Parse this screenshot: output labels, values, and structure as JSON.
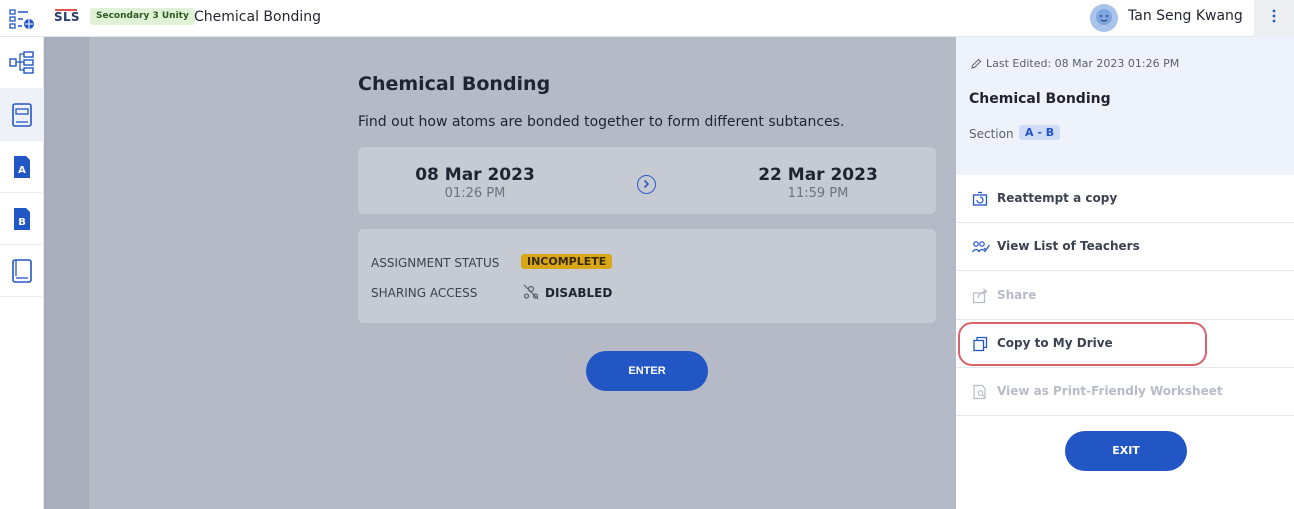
{
  "topbar": {
    "logo": "SLS",
    "class_badge": "Secondary 3 Unity",
    "title": "Chemical Bonding",
    "user_name": "Tan Seng Kwang",
    "menu_icon": "kebab-menu-icon"
  },
  "leftrail": {
    "items": [
      {
        "icon": "lesson-map-icon",
        "active": false
      },
      {
        "icon": "notebook-icon",
        "active": true
      },
      {
        "icon": "section-a-icon",
        "label": "A",
        "active": false
      },
      {
        "icon": "section-b-icon",
        "label": "B",
        "active": false
      },
      {
        "icon": "book-icon",
        "active": false
      }
    ]
  },
  "main": {
    "title": "Chemical Bonding",
    "description": "Find out how atoms are bonded together to form different subtances.",
    "start_date": "08 Mar 2023",
    "start_time": "01:26 PM",
    "end_date": "22 Mar 2023",
    "end_time": "11:59 PM",
    "assignment_status_label": "ASSIGNMENT STATUS",
    "assignment_status_value": "INCOMPLETE",
    "sharing_access_label": "SHARING ACCESS",
    "sharing_access_value": "DISABLED",
    "enter_label": "ENTER"
  },
  "panel": {
    "last_edited": "Last Edited: 08 Mar 2023 01:26 PM",
    "title": "Chemical Bonding",
    "section_label": "Section",
    "section_value": "A - B",
    "actions": [
      {
        "label": "Reattempt a copy",
        "icon": "reattempt-icon",
        "enabled": true
      },
      {
        "label": "View List of Teachers",
        "icon": "teachers-icon",
        "enabled": true
      },
      {
        "label": "Share",
        "icon": "share-icon",
        "enabled": false
      },
      {
        "label": "Copy to My Drive",
        "icon": "copy-icon",
        "enabled": true,
        "highlighted": true
      },
      {
        "label": "View as Print-Friendly Worksheet",
        "icon": "print-worksheet-icon",
        "enabled": false
      }
    ],
    "exit_label": "EXIT"
  },
  "colors": {
    "primary": "#2356c5",
    "status_incomplete": "#d7a717",
    "highlight_ring": "#d9636b",
    "overlay": "#b5bac6"
  }
}
